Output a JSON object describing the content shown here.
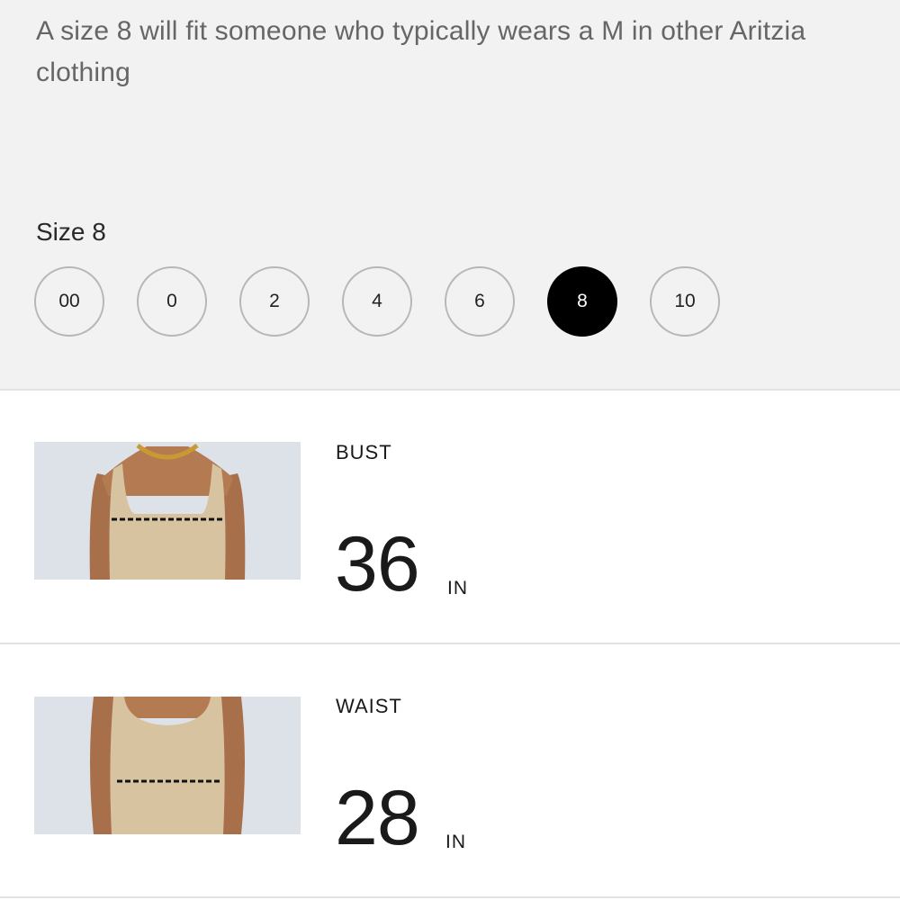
{
  "fit_note": "A size 8 will fit someone who typically wears a M in other Aritzia clothing",
  "size_label": "Size 8",
  "sizes": [
    "00",
    "0",
    "2",
    "4",
    "6",
    "8",
    "10"
  ],
  "selected_size": "8",
  "measurements": [
    {
      "name": "BUST",
      "value": "36",
      "unit": "IN",
      "image": "bust-measurement-photo"
    },
    {
      "name": "WAIST",
      "value": "28",
      "unit": "IN",
      "image": "waist-measurement-photo"
    }
  ],
  "colors": {
    "panel_bg": "#f2f2f2",
    "selected_chip": "#000000",
    "chip_border": "#b7b7b7",
    "note_text": "#666666"
  }
}
